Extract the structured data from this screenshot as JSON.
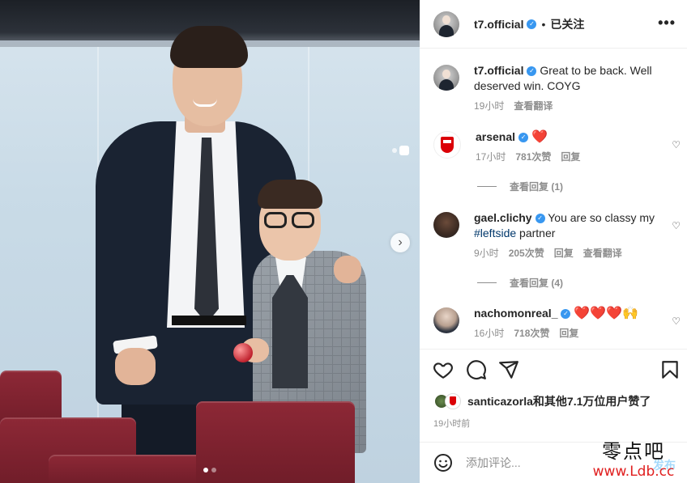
{
  "post": {
    "author": "t7.official",
    "follow_status": "已关注",
    "caption": "Great to be back. Well deserved win. COYG",
    "caption_time": "19小时",
    "caption_translate": "查看翻译",
    "carousel_dots": 2,
    "active_dot": 0
  },
  "comments": [
    {
      "user": "arsenal",
      "verified": true,
      "text": "❤️",
      "time": "17小时",
      "likes": "781次赞",
      "reply": "回复",
      "replies": "查看回复 (1)"
    },
    {
      "user": "gael.clichy",
      "verified": true,
      "text_before": "You are so classy my ",
      "hashtag": "#leftside",
      "text_after": " partner",
      "time": "9小时",
      "likes": "205次赞",
      "reply": "回复",
      "translate": "查看翻译",
      "replies": "查看回复 (4)"
    },
    {
      "user": "nachomonreal_",
      "verified": true,
      "text": "❤️❤️❤️🙌",
      "time": "16小时",
      "likes": "718次赞",
      "reply": "回复"
    }
  ],
  "likes_summary": "santicazorla和其他7.1万位用户赞了",
  "post_time": "19小时前",
  "add_comment": {
    "placeholder": "添加评论...",
    "post_label": "发布"
  },
  "watermark": {
    "line1": "零点吧",
    "line2": "www.Ldb.cc"
  },
  "colors": {
    "verified": "#3897f0",
    "link": "#00376b",
    "post_button": "#0095f6",
    "heart": "#ed1c24"
  },
  "icons": [
    "more-icon",
    "heart-icon",
    "comment-icon",
    "share-icon",
    "bookmark-icon",
    "emoji-icon",
    "next-arrow-icon"
  ]
}
